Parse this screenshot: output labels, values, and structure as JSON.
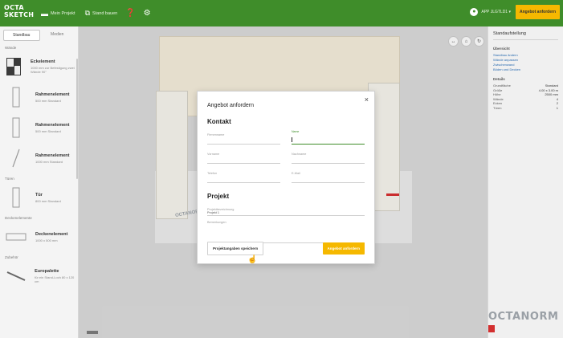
{
  "topbar": {
    "logo_line1": "OCTA",
    "logo_line2": "SKETCH",
    "menu_project": "Mein Projekt",
    "menu_stand": "Stand bauen",
    "user": "APP JLGTLD1 ▾",
    "cta": "Angebot anfordern"
  },
  "sidebar": {
    "tabs": [
      "Standbau",
      "Medien"
    ],
    "categories": [
      {
        "title": "Wände",
        "items": [
          {
            "name": "Eckelement",
            "sub": "1000 mm\nzur Befestigung zwei Wände 90°"
          },
          {
            "name": "Rahmenelement",
            "sub": "500 mm\nStandard"
          },
          {
            "name": "Rahmenelement",
            "sub": "500 mm\nStandard"
          },
          {
            "name": "Rahmenelement",
            "sub": "1000 mm\nStandard"
          }
        ]
      },
      {
        "title": "Türen",
        "items": [
          {
            "name": "Tür",
            "sub": "800 mm\nStandard"
          }
        ]
      },
      {
        "title": "Deckenelemente",
        "items": [
          {
            "name": "Deckenelement",
            "sub": "1000 x 500 mm"
          }
        ]
      },
      {
        "title": "Zubehör",
        "items": [
          {
            "name": "Europalette",
            "sub": "für ein Stand-Loch\n80 x 120 cm"
          }
        ]
      }
    ]
  },
  "rpanel": {
    "title": "Standaufstellung",
    "links": [
      "Standbau ändern",
      "Wände anpassen",
      "Zwischenwand",
      "Böden und Decken"
    ],
    "rows": [
      {
        "k": "Grundfläche",
        "v": "Standard"
      },
      {
        "k": "Größe",
        "v": "4.00 x 3.00 m"
      },
      {
        "k": "Höhe",
        "v": "2500 mm"
      },
      {
        "k": "Wände",
        "v": "4"
      },
      {
        "k": "Ecken",
        "v": "2"
      },
      {
        "k": "Türen",
        "v": "1"
      }
    ],
    "brand": "OCTANORM"
  },
  "modal": {
    "title": "Angebot anfordern",
    "close": "×",
    "contact_heading": "Kontakt",
    "fields_contact": [
      [
        "Firmenname",
        "Name"
      ],
      [
        "Vorname",
        "Nachname"
      ],
      [
        "Telefon",
        "E-Mail"
      ]
    ],
    "project_heading": "Projekt",
    "project_field": "Projektbezeichnung",
    "project_value": "Projekt 1",
    "message_label": "Bemerkungen",
    "btn_save": "Projektangaben speichern",
    "btn_request": "Angebot anfordern"
  },
  "canvas": {
    "view_controls": [
      "↔",
      "⌂",
      "↻"
    ],
    "brand_floor": "OCTANORM"
  }
}
